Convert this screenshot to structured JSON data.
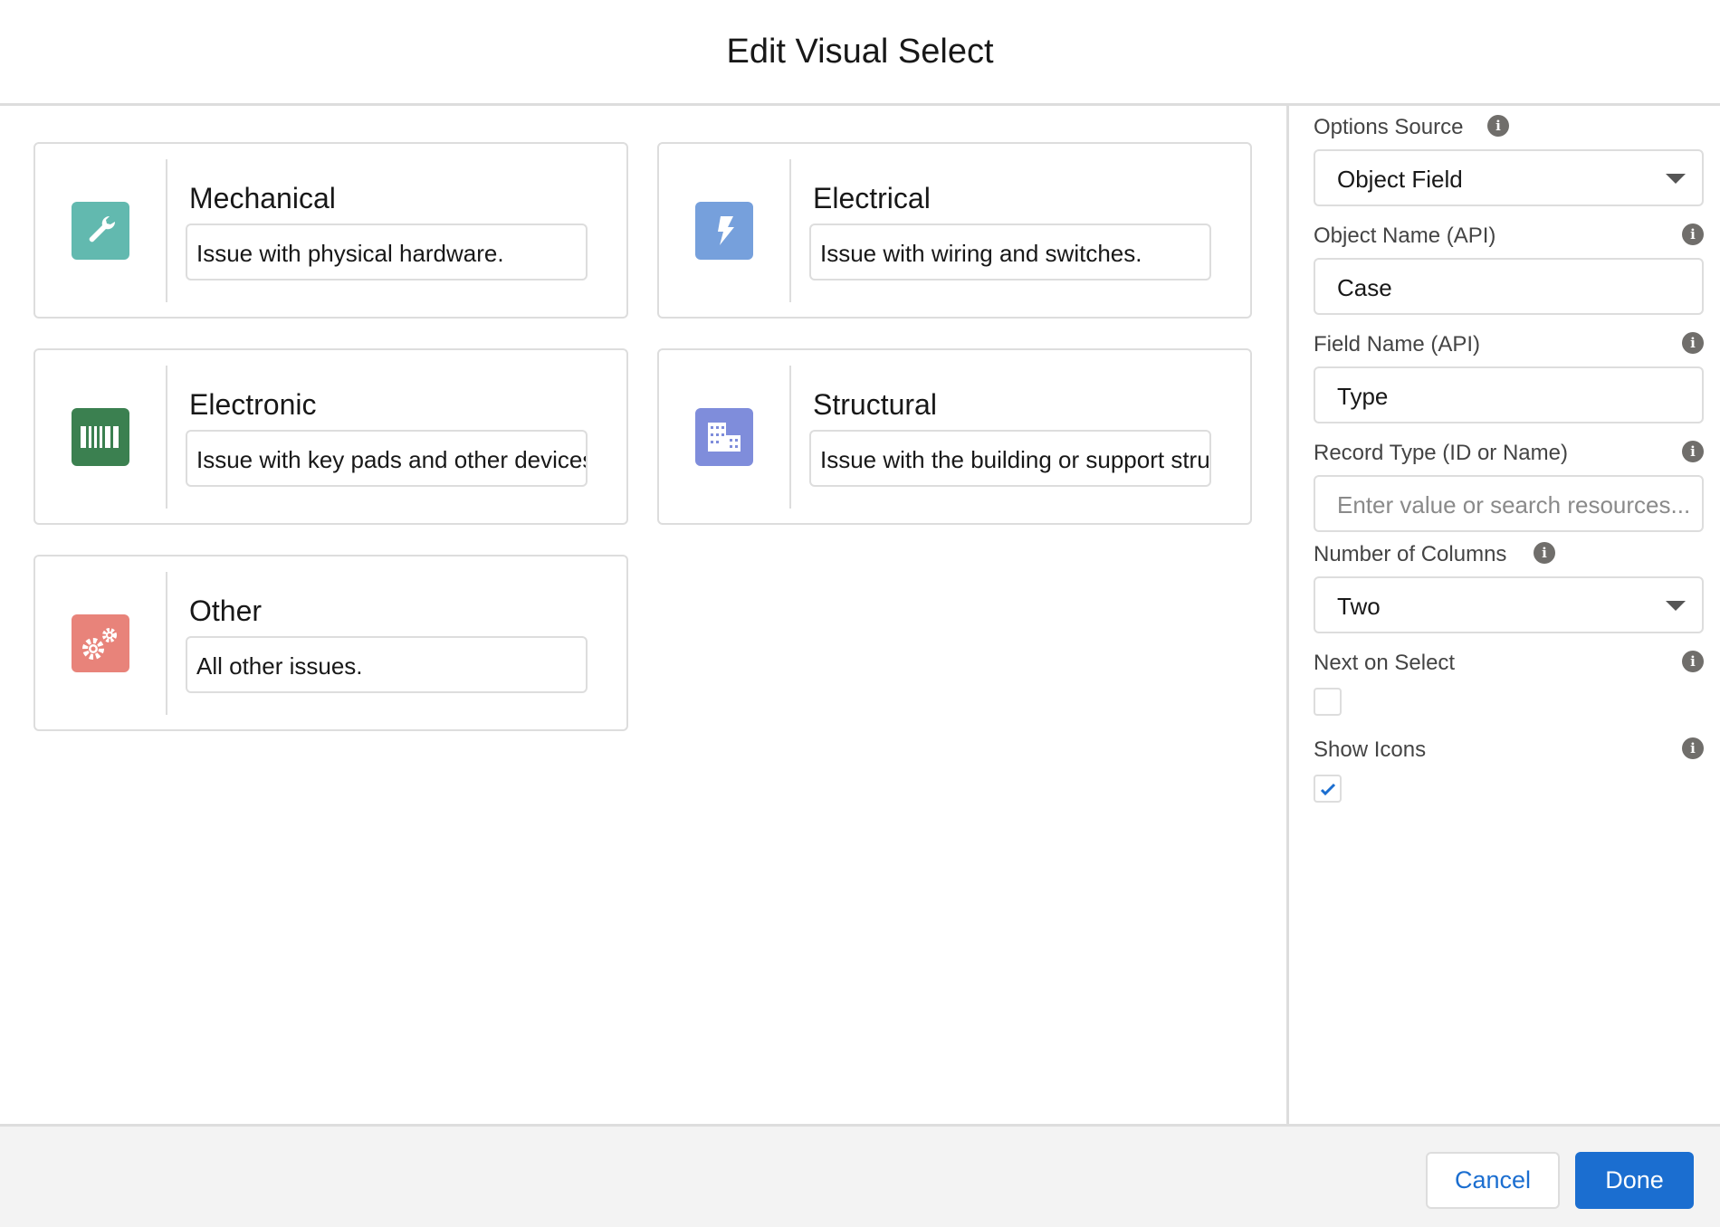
{
  "header": {
    "title": "Edit Visual Select"
  },
  "options": [
    {
      "title": "Mechanical",
      "description": "Issue with physical hardware.",
      "icon": "wrench-icon",
      "color": "#62b9af"
    },
    {
      "title": "Electrical",
      "description": "Issue with wiring and switches.",
      "icon": "lightning-bolt-icon",
      "color": "#76a0dc"
    },
    {
      "title": "Electronic",
      "description": "Issue with key pads and other devices.",
      "icon": "barcode-icon",
      "color": "#3b8050"
    },
    {
      "title": "Structural",
      "description": "Issue with the building or support structure.",
      "icon": "building-icon",
      "color": "#7f8ddb"
    },
    {
      "title": "Other",
      "description": "All other issues.",
      "icon": "gears-icon",
      "color": "#e8837a"
    }
  ],
  "panel": {
    "options_source": {
      "label": "Options Source",
      "value": "Object Field"
    },
    "object_name": {
      "label": "Object Name (API)",
      "value": "Case"
    },
    "field_name": {
      "label": "Field Name (API)",
      "value": "Type"
    },
    "record_type": {
      "label": "Record Type (ID or Name)",
      "placeholder": "Enter value or search resources..."
    },
    "columns": {
      "label": "Number of Columns",
      "value": "Two"
    },
    "next_on_select": {
      "label": "Next on Select",
      "checked": false
    },
    "show_icons": {
      "label": "Show Icons",
      "checked": true
    },
    "info_glyph": "i"
  },
  "footer": {
    "cancel": "Cancel",
    "done": "Done",
    "accent": "#1b6ed0"
  }
}
